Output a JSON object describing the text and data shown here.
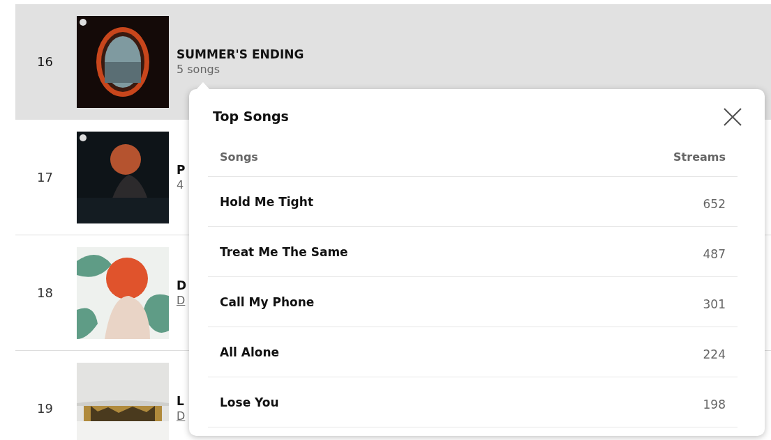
{
  "playlists": [
    {
      "rank": "16",
      "title": "SUMMER'S ENDING",
      "subtitle": {
        "text": "5 songs",
        "kind": "text"
      },
      "selected": true
    },
    {
      "rank": "17",
      "title": "P",
      "subtitle": {
        "text": "4",
        "kind": "text"
      },
      "selected": false
    },
    {
      "rank": "18",
      "title": "D",
      "subtitle": {
        "text": "D",
        "kind": "link"
      },
      "selected": false
    },
    {
      "rank": "19",
      "title": "L",
      "subtitle": {
        "text": "D",
        "kind": "link"
      },
      "selected": false
    }
  ],
  "popup": {
    "title": "Top Songs",
    "columns": [
      "Songs",
      "Streams"
    ],
    "rows": [
      {
        "song": "Hold Me Tight",
        "streams": "652"
      },
      {
        "song": "Treat Me The Same",
        "streams": "487"
      },
      {
        "song": "Call My Phone",
        "streams": "301"
      },
      {
        "song": "All Alone",
        "streams": "224"
      },
      {
        "song": "Lose You",
        "streams": "198"
      }
    ]
  }
}
